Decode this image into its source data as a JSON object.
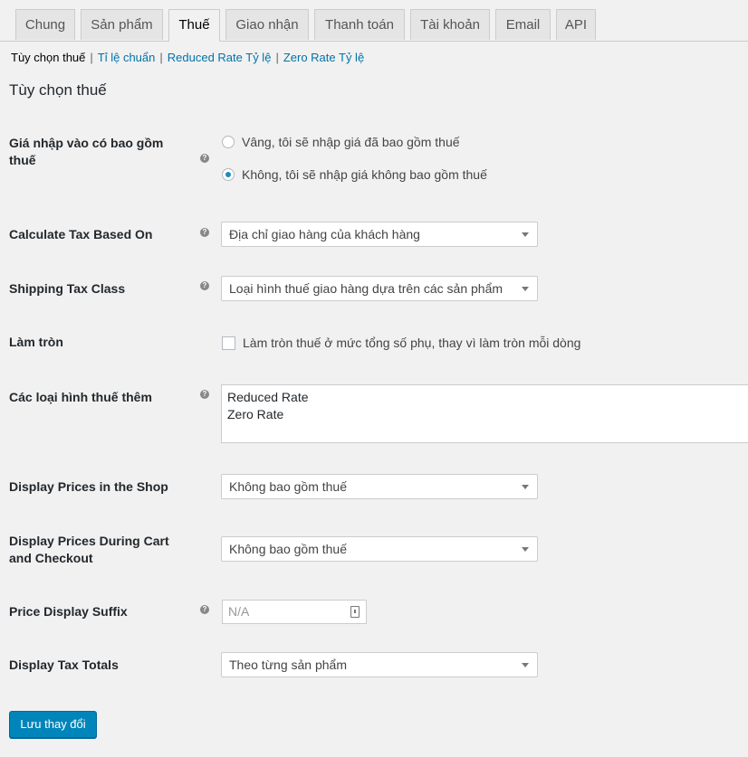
{
  "tabs": [
    {
      "label": "Chung",
      "active": false
    },
    {
      "label": "Sản phẩm",
      "active": false
    },
    {
      "label": "Thuế",
      "active": true
    },
    {
      "label": "Giao nhận",
      "active": false
    },
    {
      "label": "Thanh toán",
      "active": false
    },
    {
      "label": "Tài khoản",
      "active": false
    },
    {
      "label": "Email",
      "active": false
    },
    {
      "label": "API",
      "active": false
    }
  ],
  "subnav": {
    "current": "Tùy chọn thuế",
    "links": [
      "Tỉ lệ chuẩn",
      "Reduced Rate Tỷ lệ",
      "Zero Rate Tỷ lệ"
    ],
    "separator": "|"
  },
  "section_title": "Tùy chọn thuế",
  "fields": {
    "prices_include_tax": {
      "label": "Giá nhập vào có bao gồm thuế",
      "options": [
        {
          "label": "Vâng, tôi sẽ nhập giá đã bao gồm thuế",
          "selected": false
        },
        {
          "label": "Không, tôi sẽ nhập giá không bao gồm thuế",
          "selected": true
        }
      ]
    },
    "tax_based_on": {
      "label": "Calculate Tax Based On",
      "value": "Địa chỉ giao hàng của khách hàng"
    },
    "shipping_tax_class": {
      "label": "Shipping Tax Class",
      "value": "Loại hình thuế giao hàng dựa trên các sản phẩm"
    },
    "rounding": {
      "label": "Làm tròn",
      "checkbox_label": "Làm tròn thuế ở mức tổng số phụ, thay vì làm tròn mỗi dòng",
      "checked": false
    },
    "additional_classes": {
      "label": "Các loại hình thuế thêm",
      "lines": [
        "Reduced Rate",
        "Zero Rate"
      ]
    },
    "display_shop": {
      "label": "Display Prices in the Shop",
      "value": "Không bao gồm thuế"
    },
    "display_cart": {
      "label": "Display Prices During Cart and Checkout",
      "value": "Không bao gồm thuế"
    },
    "price_suffix": {
      "label": "Price Display Suffix",
      "placeholder": "N/A"
    },
    "tax_totals": {
      "label": "Display Tax Totals",
      "value": "Theo từng sản phẩm"
    }
  },
  "save_label": "Lưu thay đổi",
  "colors": {
    "accent": "#0073aa",
    "button": "#0085ba",
    "radio_dot": "#1e8cbe"
  },
  "icons": {
    "help": "question-circle-icon",
    "dropdown": "chevron-down-icon",
    "keyboard": "keyboard-icon"
  }
}
